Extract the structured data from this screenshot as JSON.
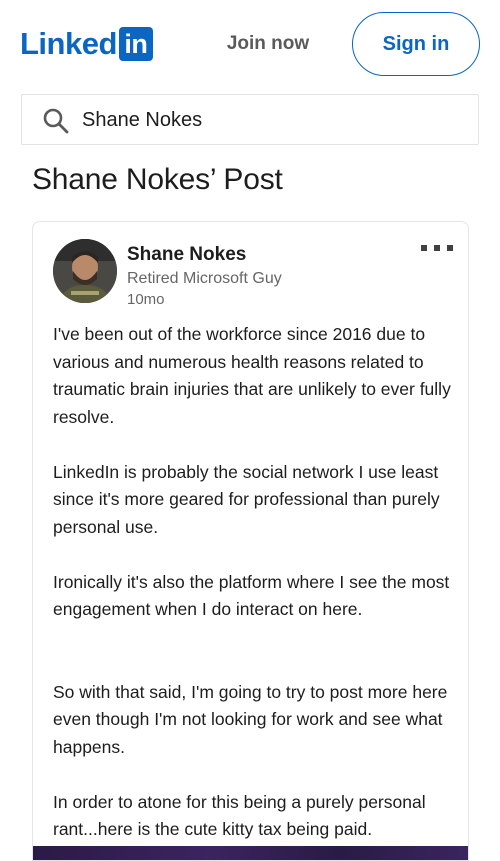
{
  "header": {
    "logo_text": "Linked",
    "logo_box_text": "in",
    "join_label": "Join now",
    "signin_label": "Sign in"
  },
  "search": {
    "value": "Shane Nokes"
  },
  "page_title": "Shane Nokes’ Post",
  "post": {
    "author_name": "Shane Nokes",
    "author_headline": "Retired Microsoft Guy",
    "time": "10mo",
    "paragraphs": [
      "I've been out of the workforce since 2016 due to various and numerous health reasons related to traumatic brain injuries that are unlikely to ever fully resolve.",
      "LinkedIn is probably the social network I use least since it's more geared for professional than purely personal use.",
      "Ironically it's also the platform where I see the most engagement when I do interact on here.",
      "So with that said, I'm going to try to post more here even though I'm not looking for work and see what happens.",
      "In order to atone for this being a purely personal rant...here is the cute kitty tax being paid."
    ]
  },
  "icons": {
    "search": "search-icon",
    "more": "more-options-icon"
  },
  "colors": {
    "brand": "#0a66c2",
    "text": "#1d1d1d",
    "muted": "#666666"
  }
}
